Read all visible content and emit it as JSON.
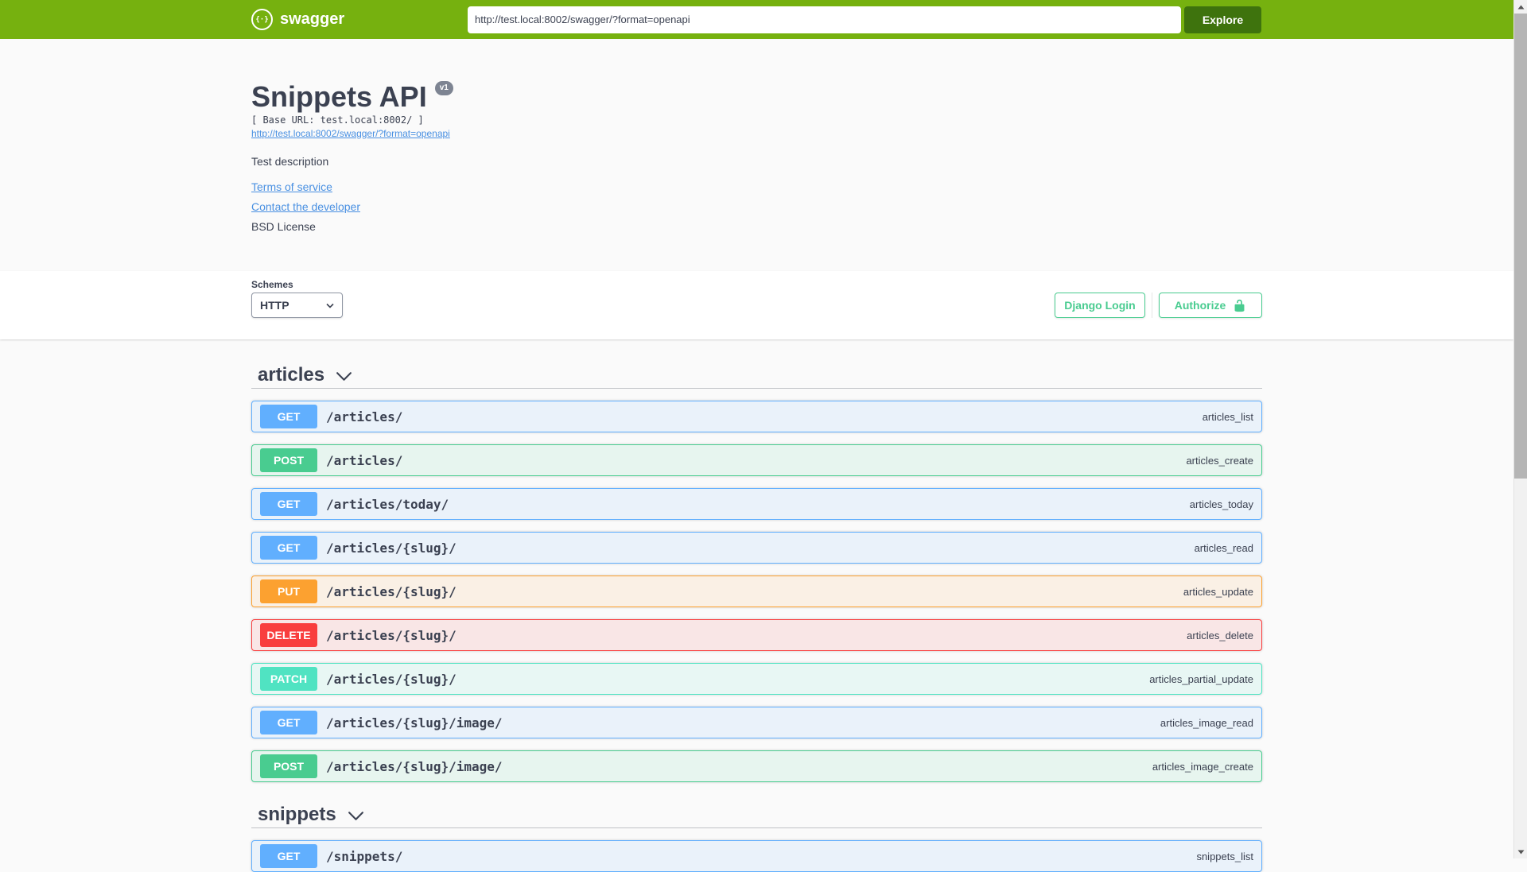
{
  "topbar": {
    "brand": "swagger",
    "logo_icon": "swagger-logo-icon",
    "url_input_value": "http://test.local:8002/swagger/?format=openapi",
    "explore_button": "Explore",
    "bar_color": "#76b10f",
    "explore_button_color": "#3e730d"
  },
  "info": {
    "title": "Snippets API",
    "version_badge": "v1",
    "base_url_text": "[ Base URL: test.local:8002/ ]",
    "spec_link": "http://test.local:8002/swagger/?format=openapi",
    "description": "Test description",
    "terms_link": "Terms of service",
    "contact_link": "Contact the developer",
    "license_text": "BSD License",
    "link_color": "#4990e2",
    "text_color": "#3b4151"
  },
  "schemes": {
    "label": "Schemes",
    "selected_option": "HTTP",
    "select_icon": "chevron-down-icon",
    "django_login_button": "Django Login",
    "authorize_button": "Authorize",
    "authorize_icon": "unlock-icon",
    "accent_color": "#49cc90"
  },
  "tags": [
    {
      "name": "articles",
      "expand_icon": "chevron-down-icon",
      "operations": [
        {
          "method": "GET",
          "path": "/articles/",
          "operation_id": "articles_list"
        },
        {
          "method": "POST",
          "path": "/articles/",
          "operation_id": "articles_create"
        },
        {
          "method": "GET",
          "path": "/articles/today/",
          "operation_id": "articles_today"
        },
        {
          "method": "GET",
          "path": "/articles/{slug}/",
          "operation_id": "articles_read"
        },
        {
          "method": "PUT",
          "path": "/articles/{slug}/",
          "operation_id": "articles_update"
        },
        {
          "method": "DELETE",
          "path": "/articles/{slug}/",
          "operation_id": "articles_delete"
        },
        {
          "method": "PATCH",
          "path": "/articles/{slug}/",
          "operation_id": "articles_partial_update"
        },
        {
          "method": "GET",
          "path": "/articles/{slug}/image/",
          "operation_id": "articles_image_read"
        },
        {
          "method": "POST",
          "path": "/articles/{slug}/image/",
          "operation_id": "articles_image_create"
        }
      ]
    },
    {
      "name": "snippets",
      "expand_icon": "chevron-down-icon",
      "operations": [
        {
          "method": "GET",
          "path": "/snippets/",
          "operation_id": "snippets_list"
        }
      ]
    }
  ],
  "method_colors": {
    "GET": {
      "badge": "#61affe",
      "background": "rgba(97,175,254,0.1)",
      "border": "#61affe"
    },
    "POST": {
      "badge": "#49cc90",
      "background": "rgba(73,204,144,0.1)",
      "border": "#49cc90"
    },
    "PUT": {
      "badge": "#fca130",
      "background": "rgba(252,161,48,0.1)",
      "border": "#fca130"
    },
    "DELETE": {
      "badge": "#f93e3e",
      "background": "rgba(249,62,62,0.1)",
      "border": "#f93e3e"
    },
    "PATCH": {
      "badge": "#50e3c2",
      "background": "rgba(80,227,194,0.1)",
      "border": "#50e3c2"
    }
  },
  "scrollbar": {
    "up_icon": "triangle-up-icon",
    "down_icon": "triangle-down-icon"
  }
}
